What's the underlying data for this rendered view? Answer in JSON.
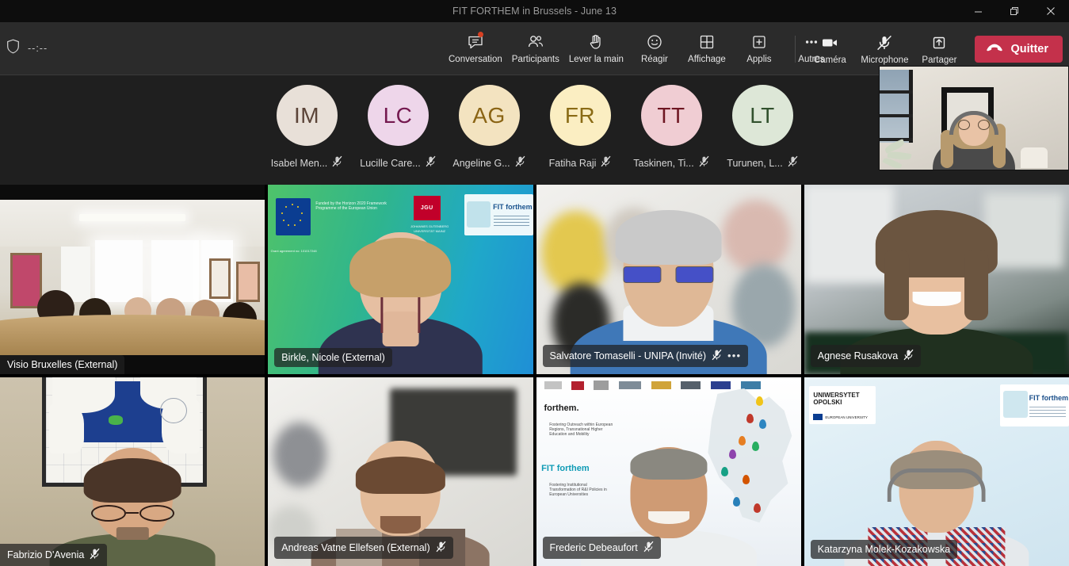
{
  "window": {
    "title": "FIT FORTHEM in Brussels - June 13",
    "controls": [
      {
        "name": "minimize",
        "glyph": "minimize-icon"
      },
      {
        "name": "restore",
        "glyph": "restore-icon"
      },
      {
        "name": "close",
        "glyph": "close-icon"
      }
    ]
  },
  "toolbar": {
    "shield_icon": "shield-icon",
    "timer": "--:--",
    "center_buttons": [
      {
        "label": "Conversation",
        "icon": "chat-icon",
        "badge": true
      },
      {
        "label": "Participants",
        "icon": "people-icon",
        "badge": false
      },
      {
        "label": "Lever la main",
        "icon": "raise-hand-icon",
        "badge": false
      },
      {
        "label": "Réagir",
        "icon": "smiley-icon",
        "badge": false
      },
      {
        "label": "Affichage",
        "icon": "grid-view-icon",
        "badge": false
      },
      {
        "label": "Applis",
        "icon": "plus-box-icon",
        "badge": false
      },
      {
        "label": "Autres",
        "icon": "ellipsis-icon",
        "badge": false
      }
    ],
    "right_buttons": [
      {
        "label": "Caméra",
        "icon": "camera-icon",
        "state": "on"
      },
      {
        "label": "Microphone",
        "icon": "mic-off-icon",
        "state": "muted"
      },
      {
        "label": "Partager",
        "icon": "share-up-icon",
        "state": "off"
      }
    ],
    "leave": {
      "label": "Quitter",
      "icon": "hangup-icon",
      "color": "#c4314b"
    }
  },
  "avatars": [
    {
      "initials": "IM",
      "name": "Isabel Men...",
      "bg": "#e8e0d8",
      "fg": "#5b4438",
      "muted": true
    },
    {
      "initials": "LC",
      "name": "Lucille Care...",
      "bg": "#eed6ea",
      "fg": "#74194f",
      "muted": true
    },
    {
      "initials": "AG",
      "name": "Angeline G...",
      "bg": "#f3e3c0",
      "fg": "#8a6414",
      "muted": true
    },
    {
      "initials": "FR",
      "name": "Fatiha Raji",
      "bg": "#fbeec2",
      "fg": "#8a6b15",
      "muted": true
    },
    {
      "initials": "TT",
      "name": "Taskinen, Ti...",
      "bg": "#f0cdd3",
      "fg": "#6e1622",
      "muted": true
    },
    {
      "initials": "LT",
      "name": "Turunen, L...",
      "bg": "#dde7d7",
      "fg": "#31512d",
      "muted": true
    }
  ],
  "self_view": {
    "name": "self-video-preview"
  },
  "tiles": [
    {
      "name": "Visio Bruxelles (External)",
      "muted": false,
      "more": false,
      "active_speaker": true,
      "scene": "meeting-room"
    },
    {
      "name": "Birkle, Nicole (External)",
      "muted": false,
      "more": false,
      "active_speaker": false,
      "scene": "slide-teal"
    },
    {
      "name": "Salvatore Tomaselli - UNIPA (Invité)",
      "muted": true,
      "more": true,
      "active_speaker": false,
      "scene": "office-blur"
    },
    {
      "name": "Agnese Rusakova",
      "muted": true,
      "more": false,
      "active_speaker": false,
      "scene": "indoor-dark"
    },
    {
      "name": "Fabrizio D'Avenia",
      "muted": true,
      "more": false,
      "active_speaker": false,
      "scene": "wall-chart"
    },
    {
      "name": "Andreas Vatne Ellefsen (External)",
      "muted": true,
      "more": false,
      "active_speaker": false,
      "scene": "office-white"
    },
    {
      "name": "Frederic Debeaufort",
      "muted": true,
      "more": false,
      "active_speaker": false,
      "scene": "slide-map"
    },
    {
      "name": "Katarzyna Molek-Kozakowska",
      "muted": false,
      "more": false,
      "active_speaker": false,
      "scene": "slide-opole"
    }
  ],
  "slide_text": {
    "eu_funding": "Funded by the Horizon 2020 Framework Programme of the European Union",
    "grant": "Grant agreement no: 101017248",
    "jgu": "JGU",
    "jgu_sub": "JOHANNES GUTENBERG UNIVERSITÄT MAINZ",
    "fit_forthem": "FIT forthem",
    "forthem": "forthem.",
    "forthem_sub": "Fostering Outreach within European Regions, Transnational Higher Education and Mobility",
    "fit_sub": "Fostering Institutional Transformation of R&I Policies in European Universities",
    "uniwersytet": "UNIWERSYTET OPOLSKI",
    "european_university": "EUROPEAN UNIVERSITY"
  },
  "colors": {
    "active_speaker_border": "#7b83eb",
    "leave_button": "#c4314b",
    "toolbar_bg": "#2b2b2b",
    "titlebar_bg": "#0d0d0d",
    "stage_bg": "#1f1f1f",
    "badge_dot": "#d74022"
  }
}
